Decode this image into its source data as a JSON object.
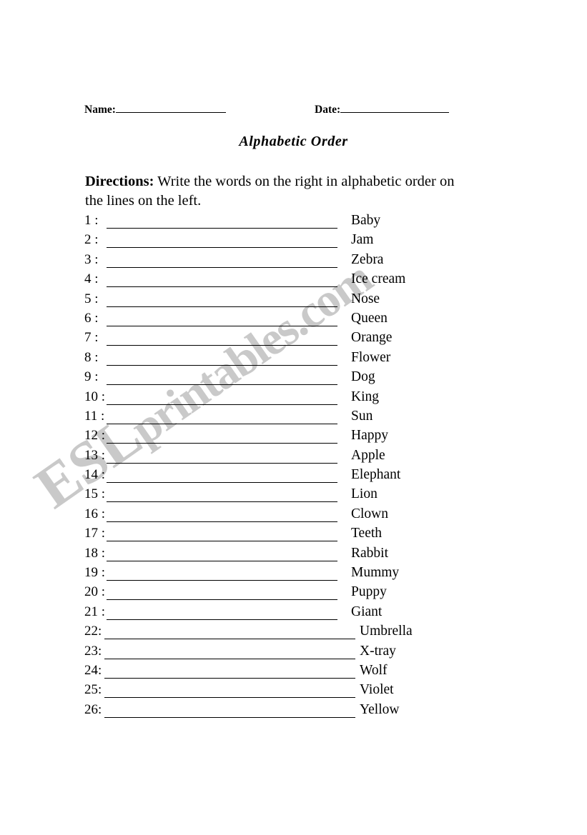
{
  "document": {
    "title": "Alphabetic Order",
    "watermark": {
      "lead": "ESL",
      "rest": "printables.com",
      "color": "#c9c9c9"
    }
  },
  "header": {
    "name_label": "Name:",
    "date_label": "Date:",
    "name_value": "",
    "date_value": ""
  },
  "directions": {
    "label": "Directions:",
    "text": " Write the words on the right in alphabetic order on the lines on the left."
  },
  "exercise": {
    "rows": [
      {
        "number": "1 :",
        "word": "Baby",
        "wide": false
      },
      {
        "number": "2 :",
        "word": "Jam",
        "wide": false
      },
      {
        "number": "3 :",
        "word": "Zebra",
        "wide": false
      },
      {
        "number": "4 :",
        "word": "Ice cream",
        "wide": false
      },
      {
        "number": "5 :",
        "word": "Nose",
        "wide": false
      },
      {
        "number": "6 :",
        "word": "Queen",
        "wide": false
      },
      {
        "number": "7 :",
        "word": "Orange",
        "wide": false
      },
      {
        "number": "8 :",
        "word": "Flower",
        "wide": false
      },
      {
        "number": "9 :",
        "word": "Dog",
        "wide": false
      },
      {
        "number": "10 :",
        "word": "King",
        "wide": false
      },
      {
        "number": "11 :",
        "word": "Sun",
        "wide": false
      },
      {
        "number": "12 :",
        "word": "Happy",
        "wide": false
      },
      {
        "number": "13 :",
        "word": "Apple",
        "wide": false
      },
      {
        "number": "14 :",
        "word": "Elephant",
        "wide": false
      },
      {
        "number": "15 :",
        "word": "Lion",
        "wide": false
      },
      {
        "number": "16 :",
        "word": "Clown",
        "wide": false
      },
      {
        "number": "17 :",
        "word": "Teeth",
        "wide": false
      },
      {
        "number": "18 :",
        "word": "Rabbit",
        "wide": false
      },
      {
        "number": "19 :",
        "word": "Mummy",
        "wide": false
      },
      {
        "number": "20 :",
        "word": "Puppy",
        "wide": false
      },
      {
        "number": "21 :",
        "word": "Giant",
        "wide": false
      },
      {
        "number": "22:",
        "word": "Umbrella",
        "wide": true
      },
      {
        "number": "23:",
        "word": "X-tray",
        "wide": true
      },
      {
        "number": "24:",
        "word": "Wolf",
        "wide": true
      },
      {
        "number": "25:",
        "word": "Violet",
        "wide": true
      },
      {
        "number": "26:",
        "word": "Yellow",
        "wide": true
      }
    ]
  }
}
